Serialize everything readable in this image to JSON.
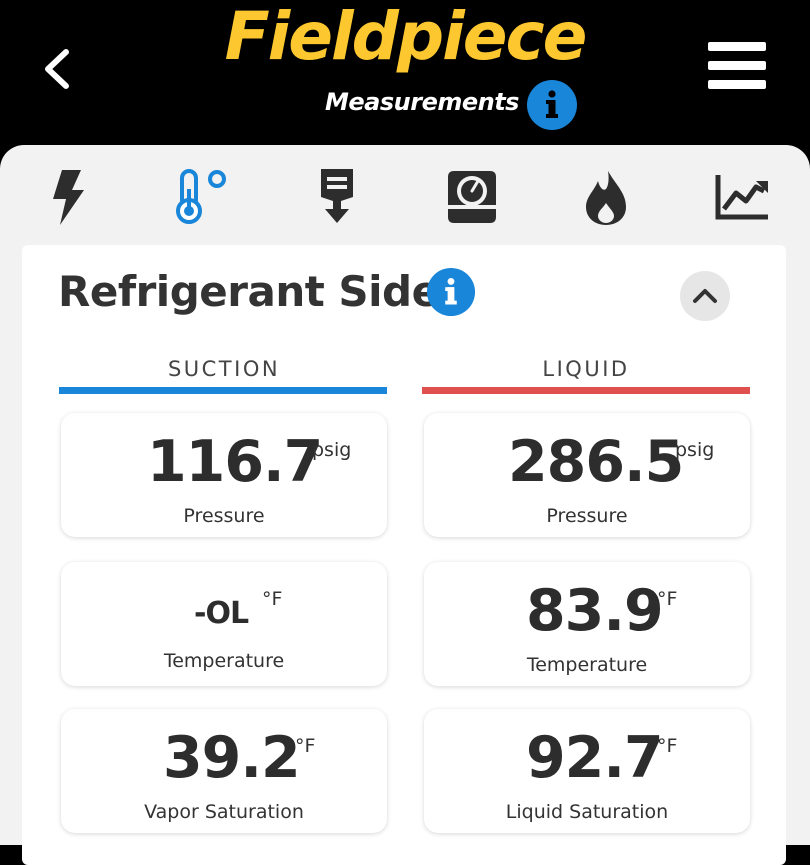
{
  "header": {
    "logo": "Fieldpiece",
    "subtitle": "Measurements",
    "logo_color": "#fdc82f",
    "info_color": "#1a86d9"
  },
  "tabs": [
    {
      "icon": "lightning-icon"
    },
    {
      "icon": "thermometer-icon",
      "active": true
    },
    {
      "icon": "download-tag-icon"
    },
    {
      "icon": "gauge-icon"
    },
    {
      "icon": "flame-icon"
    },
    {
      "icon": "chart-icon"
    }
  ],
  "section": {
    "title": "Refrigerant Side"
  },
  "columns": {
    "suction": {
      "label": "SUCTION",
      "color": "#1a86d9"
    },
    "liquid": {
      "label": "LIQUID",
      "color": "#e0504f"
    }
  },
  "readings": {
    "suction": [
      {
        "value": "116.7",
        "unit": "psig",
        "label": "Pressure"
      },
      {
        "value": "-OL",
        "unit": "°F",
        "label": "Temperature"
      },
      {
        "value": "39.2",
        "unit": "°F",
        "label": "Vapor Saturation"
      }
    ],
    "liquid": [
      {
        "value": "286.5",
        "unit": "psig",
        "label": "Pressure"
      },
      {
        "value": "83.9",
        "unit": "°F",
        "label": "Temperature"
      },
      {
        "value": "92.7",
        "unit": "°F",
        "label": "Liquid Saturation"
      }
    ]
  }
}
